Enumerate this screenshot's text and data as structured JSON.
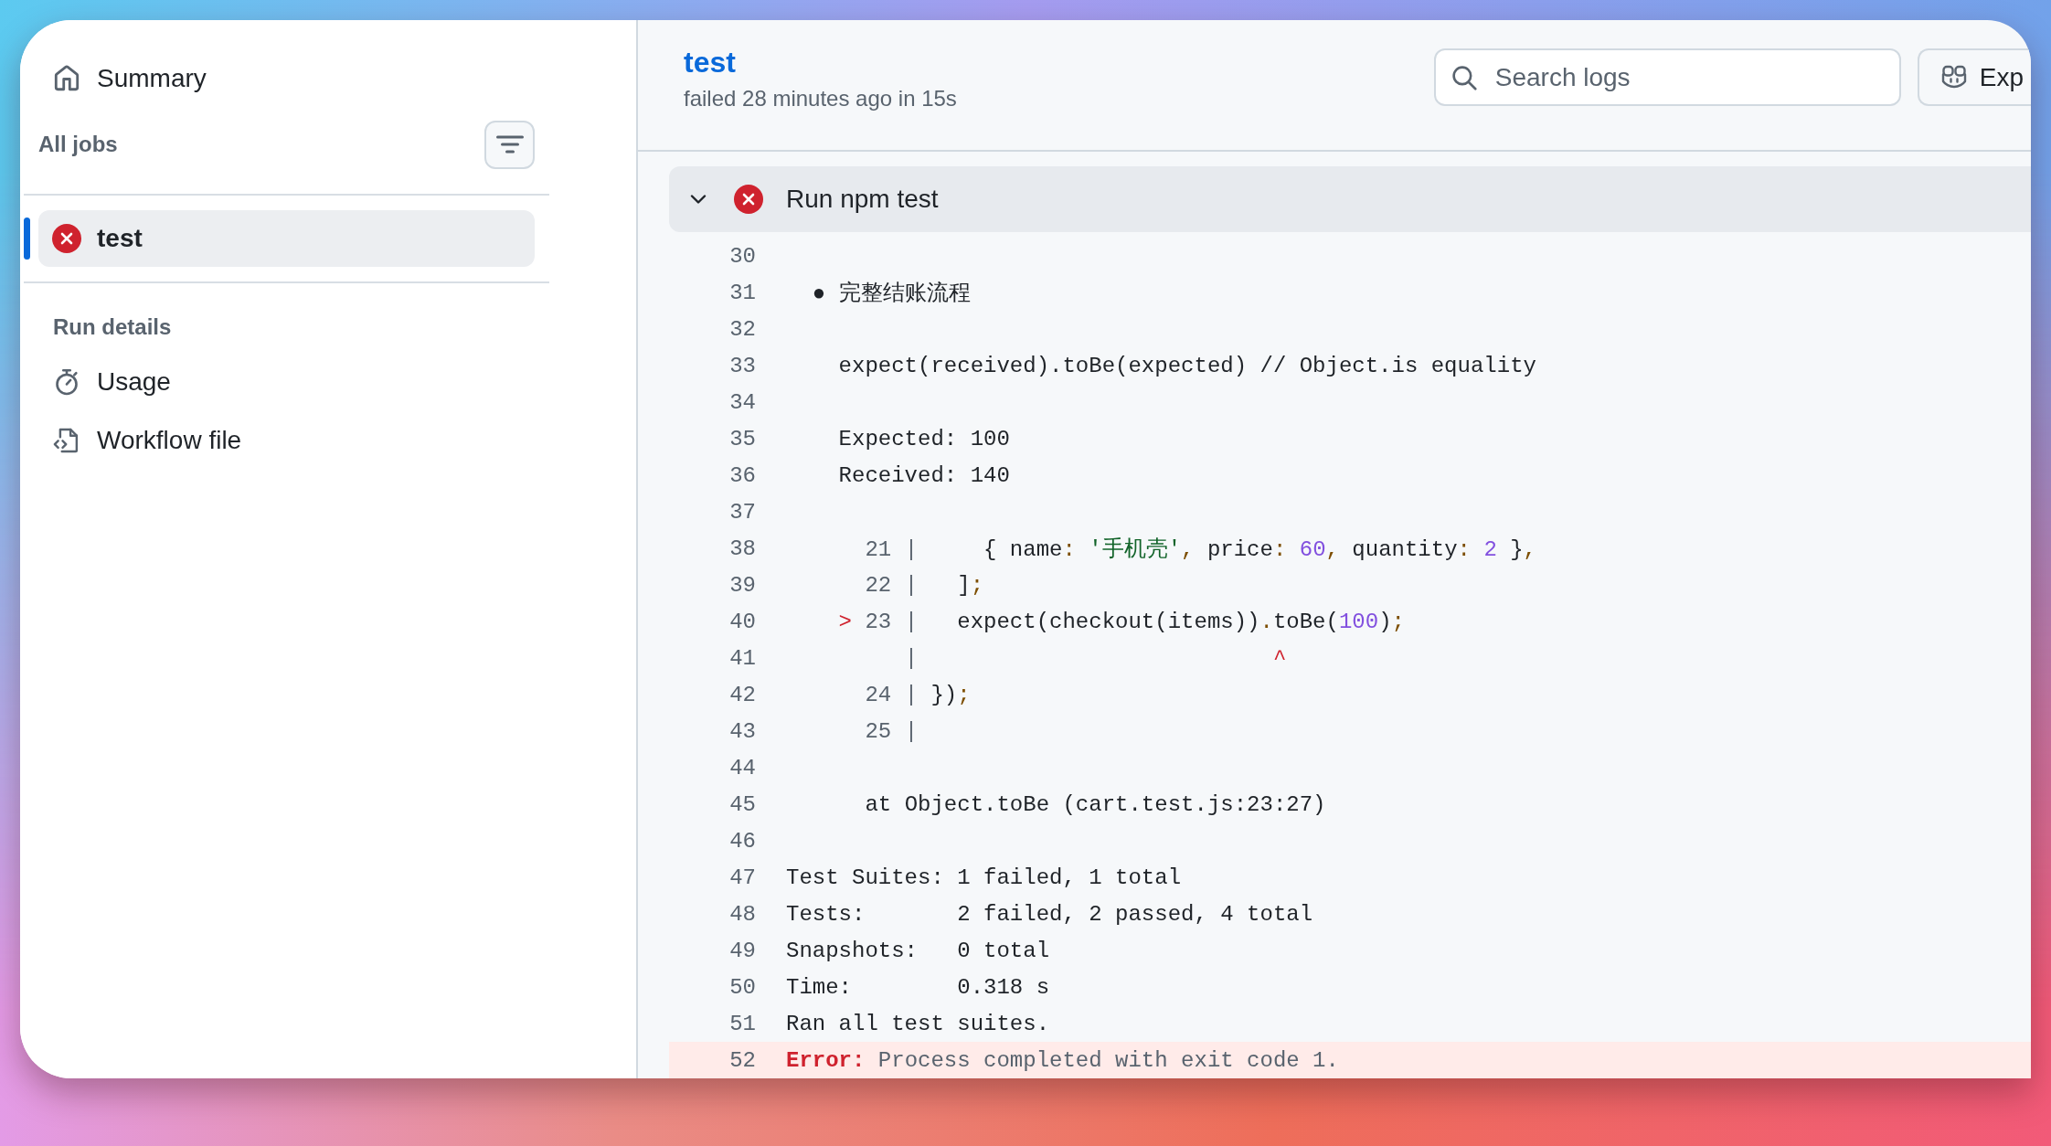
{
  "sidebar": {
    "summary": "Summary",
    "jobs_heading": "All jobs",
    "jobs": [
      {
        "name": "test",
        "failed": true,
        "selected": true
      }
    ],
    "details_heading": "Run details",
    "details_items": [
      {
        "label": "Usage"
      },
      {
        "label": "Workflow file"
      }
    ]
  },
  "header": {
    "title": "test",
    "subtitle": "failed 28 minutes ago in 15s",
    "search": {
      "placeholder": "Search logs"
    },
    "button": {
      "label": "Exp"
    }
  },
  "step": {
    "title": "Run npm test",
    "failed": true,
    "expanded": true
  },
  "log": [
    {
      "number": "30",
      "kind": "normal"
    },
    {
      "number": "31",
      "kind": "normal",
      "segments": [
        {
          "kind": "plain",
          "text": "  ● 完整结账流程"
        }
      ]
    },
    {
      "number": "32",
      "kind": "normal"
    },
    {
      "number": "33",
      "kind": "normal",
      "segments": [
        {
          "kind": "plain",
          "text": "    expect(received).toBe(expected) // Object.is equality"
        }
      ]
    },
    {
      "number": "34",
      "kind": "normal"
    },
    {
      "number": "35",
      "kind": "normal",
      "segments": [
        {
          "kind": "plain",
          "text": "    Expected: 100"
        }
      ]
    },
    {
      "number": "36",
      "kind": "normal",
      "segments": [
        {
          "kind": "plain",
          "text": "    Received: 140"
        }
      ]
    },
    {
      "number": "37",
      "kind": "normal"
    },
    {
      "number": "38",
      "kind": "normal",
      "segments": [
        {
          "kind": "dim",
          "text": "      21 |"
        },
        {
          "kind": "plain",
          "text": "     { name"
        },
        {
          "kind": "punct",
          "text": ": "
        },
        {
          "kind": "string",
          "text": "'手机壳'"
        },
        {
          "kind": "punct",
          "text": ", "
        },
        {
          "kind": "plain",
          "text": "price"
        },
        {
          "kind": "punct",
          "text": ": "
        },
        {
          "kind": "number",
          "text": "60"
        },
        {
          "kind": "punct",
          "text": ", "
        },
        {
          "kind": "plain",
          "text": "quantity"
        },
        {
          "kind": "punct",
          "text": ": "
        },
        {
          "kind": "number",
          "text": "2"
        },
        {
          "kind": "plain",
          "text": " }"
        },
        {
          "kind": "punct",
          "text": ","
        }
      ]
    },
    {
      "number": "39",
      "kind": "normal",
      "segments": [
        {
          "kind": "dim",
          "text": "      22 |"
        },
        {
          "kind": "plain",
          "text": "   ]"
        },
        {
          "kind": "punct",
          "text": ";"
        }
      ]
    },
    {
      "number": "40",
      "kind": "normal",
      "segments": [
        {
          "kind": "marker",
          "text": "    >"
        },
        {
          "kind": "dim",
          "text": " 23 |"
        },
        {
          "kind": "plain",
          "text": "   expect(checkout(items))"
        },
        {
          "kind": "punct",
          "text": "."
        },
        {
          "kind": "plain",
          "text": "toBe("
        },
        {
          "kind": "number",
          "text": "100"
        },
        {
          "kind": "plain",
          "text": ")"
        },
        {
          "kind": "punct",
          "text": ";"
        }
      ]
    },
    {
      "number": "41",
      "kind": "normal",
      "segments": [
        {
          "kind": "dim",
          "text": "         |"
        },
        {
          "kind": "marker",
          "text": "                           ^"
        }
      ]
    },
    {
      "number": "42",
      "kind": "normal",
      "segments": [
        {
          "kind": "dim",
          "text": "      24 |"
        },
        {
          "kind": "plain",
          "text": " })"
        },
        {
          "kind": "punct",
          "text": ";"
        }
      ]
    },
    {
      "number": "43",
      "kind": "normal",
      "segments": [
        {
          "kind": "dim",
          "text": "      25 |"
        }
      ]
    },
    {
      "number": "44",
      "kind": "normal"
    },
    {
      "number": "45",
      "kind": "normal",
      "segments": [
        {
          "kind": "plain",
          "text": "      at Object.toBe (cart.test.js:23:27)"
        }
      ]
    },
    {
      "number": "46",
      "kind": "normal"
    },
    {
      "number": "47",
      "kind": "normal",
      "segments": [
        {
          "kind": "plain",
          "text": "Test Suites: 1 failed, 1 total"
        }
      ]
    },
    {
      "number": "48",
      "kind": "normal",
      "segments": [
        {
          "kind": "plain",
          "text": "Tests:       2 failed, 2 passed, 4 total"
        }
      ]
    },
    {
      "number": "49",
      "kind": "normal",
      "segments": [
        {
          "kind": "plain",
          "text": "Snapshots:   0 total"
        }
      ]
    },
    {
      "number": "50",
      "kind": "normal",
      "segments": [
        {
          "kind": "plain",
          "text": "Time:        0.318 s"
        }
      ]
    },
    {
      "number": "51",
      "kind": "normal",
      "segments": [
        {
          "kind": "plain",
          "text": "Ran all test suites."
        }
      ]
    },
    {
      "number": "52",
      "kind": "error",
      "segments": [
        {
          "kind": "error",
          "text": "Error:"
        },
        {
          "kind": "muted",
          "text": " Process completed with exit code 1."
        }
      ]
    }
  ]
}
